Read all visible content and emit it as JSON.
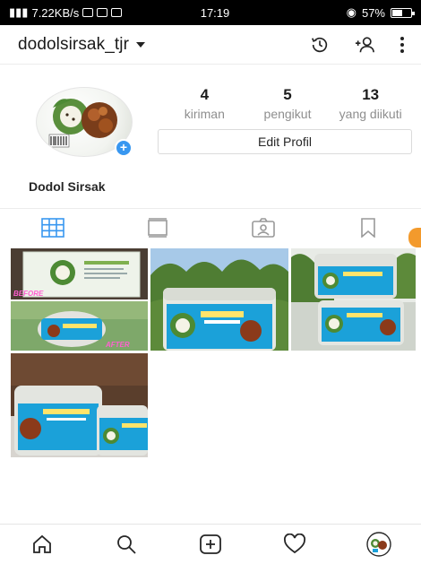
{
  "status_bar": {
    "left_text": "7.22KB/s",
    "time": "17:19",
    "battery_text": "57%",
    "battery_level": 0.57
  },
  "header": {
    "username": "dodolsirsak_tjr",
    "icons": [
      "history-icon",
      "add-person-icon",
      "more-vertical-icon"
    ]
  },
  "profile": {
    "display_name": "Dodol Sirsak",
    "stats": [
      {
        "count": "4",
        "label": "kiriman"
      },
      {
        "count": "5",
        "label": "pengikut"
      },
      {
        "count": "13",
        "label": "yang diikuti"
      }
    ],
    "edit_button": "Edit Profil"
  },
  "tabs": [
    "grid-icon",
    "feed-icon",
    "tagged-icon",
    "saved-icon"
  ],
  "posts": {
    "post_1": {
      "before_label": "BEFORE",
      "after_label": "AFTER"
    }
  },
  "bottom_nav": [
    "home-icon",
    "search-icon",
    "new-post-icon",
    "activity-icon",
    "profile-icon"
  ],
  "colors": {
    "accent": "#3897f0",
    "text": "#262626",
    "muted": "#8e8e8e",
    "border": "#dbdbdb"
  }
}
